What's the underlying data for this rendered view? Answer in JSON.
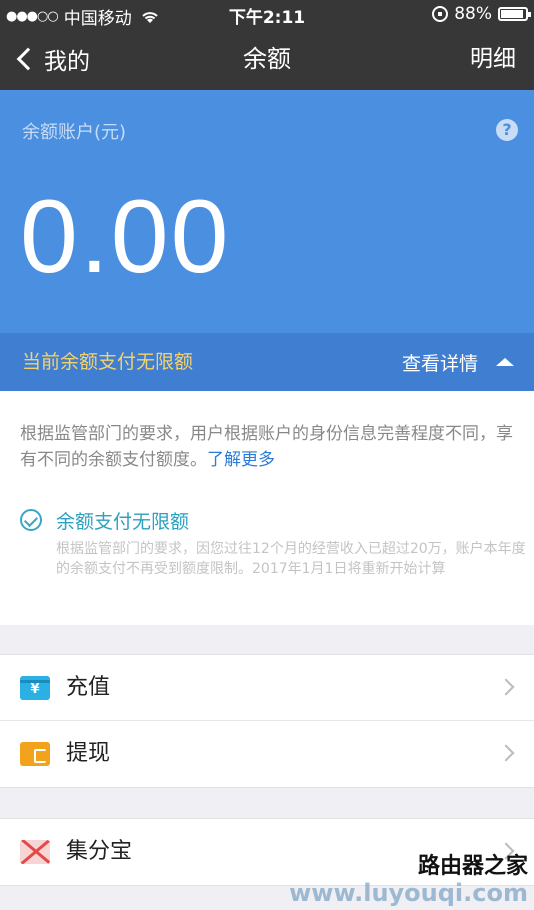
{
  "status_bar": {
    "signal": "●●●○○",
    "carrier": "中国移动",
    "time": "下午2:11",
    "battery": "88%"
  },
  "nav": {
    "back_label": "我的",
    "title": "余额",
    "detail_label": "明细"
  },
  "balance": {
    "label": "余额账户(元)",
    "help": "?",
    "amount": "0.00"
  },
  "limit_bar": {
    "text": "当前余额支付无限额",
    "view_detail": "查看详情"
  },
  "info": {
    "text": "根据监管部门的要求，用户根据账户的身份信息完善程度不同，享有不同的余额支付额度。",
    "learn_more": "了解更多",
    "unlimited_title": "余额支付无限额",
    "unlimited_desc": "根据监管部门的要求，因您过往12个月的经营收入已超过20万，账户本年度的余额支付不再受到额度限制。2017年1月1日将重新开始计算"
  },
  "actions": [
    {
      "label": "充值",
      "icon": "recharge-icon",
      "icon_text": "¥"
    },
    {
      "label": "提现",
      "icon": "withdraw-icon"
    }
  ],
  "extras": [
    {
      "label": "集分宝",
      "icon": "jifenbao-icon"
    }
  ],
  "watermark": {
    "top": "路由器之家",
    "bottom": "www.luyouqi.com"
  },
  "colors": {
    "nav_bg": "#373737",
    "balance_bg": "#4a8fe0",
    "limit_bar_bg": "#3f7ed1",
    "limit_text": "#f5d36c",
    "accent": "#2ba0bf"
  }
}
